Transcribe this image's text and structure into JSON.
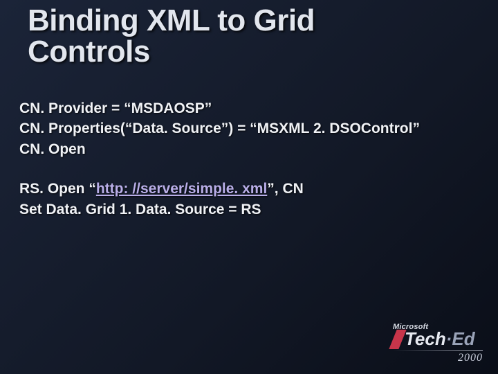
{
  "title_line1": "Binding XML to Grid",
  "title_line2": "Controls",
  "code_block1": {
    "l1": "CN. Provider = “MSDAOSP”",
    "l2": "CN. Properties(“Data. Source”) = “MSXML 2. DSOControl”",
    "l3": "CN. Open"
  },
  "code_block2": {
    "l1_pre": "RS. Open “",
    "l1_link": "http: //server/simple. xml",
    "l1_post": "”, CN",
    "l2": "Set Data. Grid 1. Data. Source = RS"
  },
  "logo": {
    "company": "Microsoft",
    "brand_tech": "Tech",
    "brand_ed": "·Ed",
    "year": "2000"
  }
}
